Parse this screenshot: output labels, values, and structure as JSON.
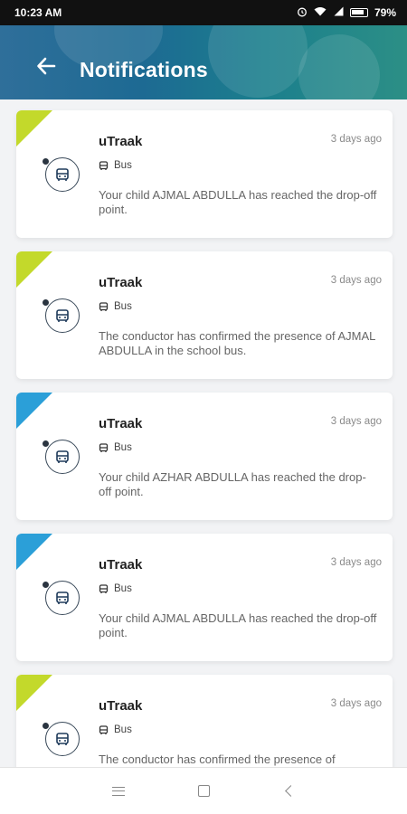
{
  "status_bar": {
    "time": "10:23 AM",
    "battery": "79%"
  },
  "header": {
    "title": "Notifications"
  },
  "notifications": [
    {
      "app": "uTraak",
      "time": "3 days ago",
      "category": "Bus",
      "message": "Your child AJMAL ABDULLA has reached the drop-off point.",
      "accent": "green"
    },
    {
      "app": "uTraak",
      "time": "3 days ago",
      "category": "Bus",
      "message": "The conductor has confirmed the presence of AJMAL ABDULLA in the school bus.",
      "accent": "green"
    },
    {
      "app": "uTraak",
      "time": "3 days ago",
      "category": "Bus",
      "message": "Your child AZHAR ABDULLA has reached the drop-off point.",
      "accent": "blue"
    },
    {
      "app": "uTraak",
      "time": "3 days ago",
      "category": "Bus",
      "message": "Your child AJMAL ABDULLA has reached the drop-off point.",
      "accent": "blue"
    },
    {
      "app": "uTraak",
      "time": "3 days ago",
      "category": "Bus",
      "message": "The conductor has confirmed the presence of",
      "accent": "green"
    }
  ],
  "colors": {
    "accent_green": "#c3d92b",
    "accent_blue": "#2b9fd8",
    "header_start": "#2f6f9a",
    "header_end": "#2c8f86"
  }
}
